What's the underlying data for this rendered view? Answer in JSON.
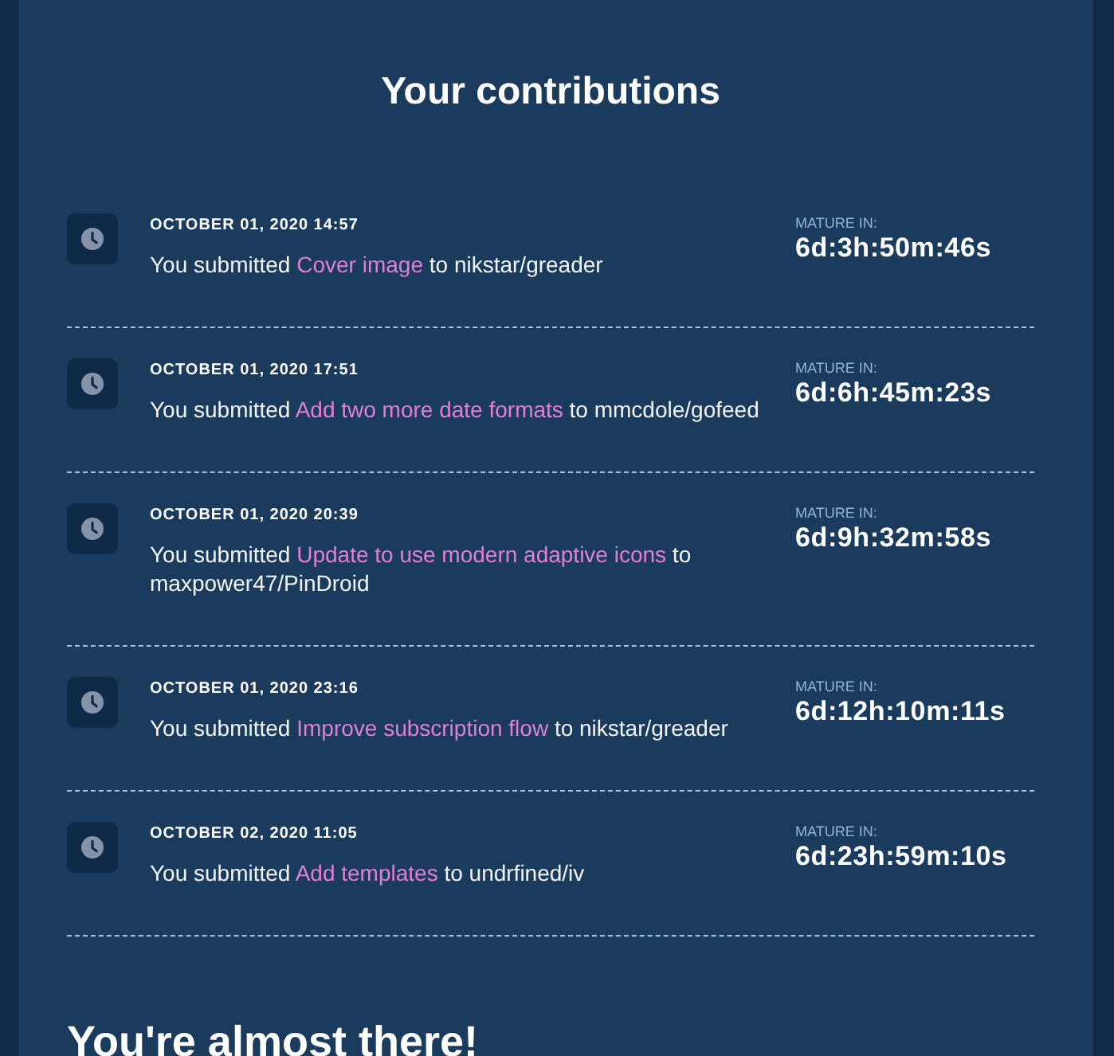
{
  "title": "Your contributions",
  "contributions": [
    {
      "date": "OCTOBER 01, 2020 14:57",
      "prefix": "You submitted",
      "link": "Cover image",
      "suffix": "to nikstar/greader",
      "mature_label": "MATURE IN:",
      "countdown": "6d:3h:50m:46s"
    },
    {
      "date": "OCTOBER 01, 2020 17:51",
      "prefix": "You submitted",
      "link": "Add two more date formats",
      "suffix": "to mmcdole/gofeed",
      "mature_label": "MATURE IN:",
      "countdown": "6d:6h:45m:23s"
    },
    {
      "date": "OCTOBER 01, 2020 20:39",
      "prefix": "You submitted",
      "link": "Update to use modern adaptive icons",
      "suffix": "to maxpower47/PinDroid",
      "mature_label": "MATURE IN:",
      "countdown": "6d:9h:32m:58s"
    },
    {
      "date": "OCTOBER 01, 2020 23:16",
      "prefix": "You submitted",
      "link": "Improve subscription flow",
      "suffix": "to nikstar/greader",
      "mature_label": "MATURE IN:",
      "countdown": "6d:12h:10m:11s"
    },
    {
      "date": "OCTOBER 02, 2020 11:05",
      "prefix": "You submitted",
      "link": "Add templates",
      "suffix": "to undrfined/iv",
      "mature_label": "MATURE IN:",
      "countdown": "6d:23h:59m:10s"
    }
  ],
  "next_heading": "You're almost there!"
}
